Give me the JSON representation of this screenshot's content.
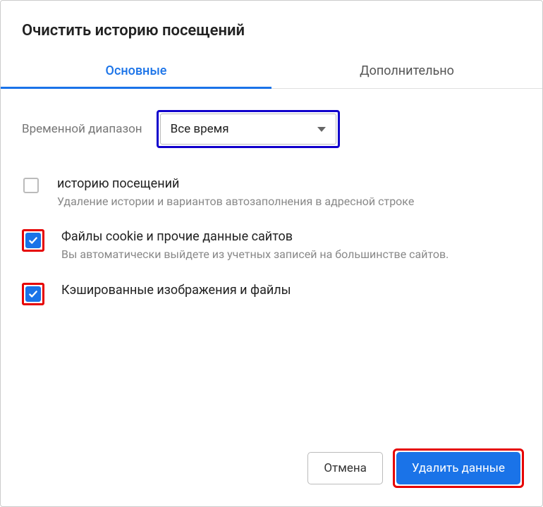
{
  "dialog": {
    "title": "Очистить историю посещений"
  },
  "tabs": {
    "basic": "Основные",
    "advanced": "Дополнительно"
  },
  "range": {
    "label": "Временной диапазон",
    "selected": "Все время"
  },
  "options": [
    {
      "checked": false,
      "highlighted": false,
      "title": "историю посещений",
      "desc": "Удаление истории и вариантов автозаполнения в адресной строке"
    },
    {
      "checked": true,
      "highlighted": true,
      "title": "Файлы cookie и прочие данные сайтов",
      "desc": "Вы автоматически выйдете из учетных записей на большинстве сайтов."
    },
    {
      "checked": true,
      "highlighted": true,
      "title": "Кэшированные изображения и файлы",
      "desc": ""
    }
  ],
  "buttons": {
    "cancel": "Отмена",
    "confirm": "Удалить данные"
  }
}
